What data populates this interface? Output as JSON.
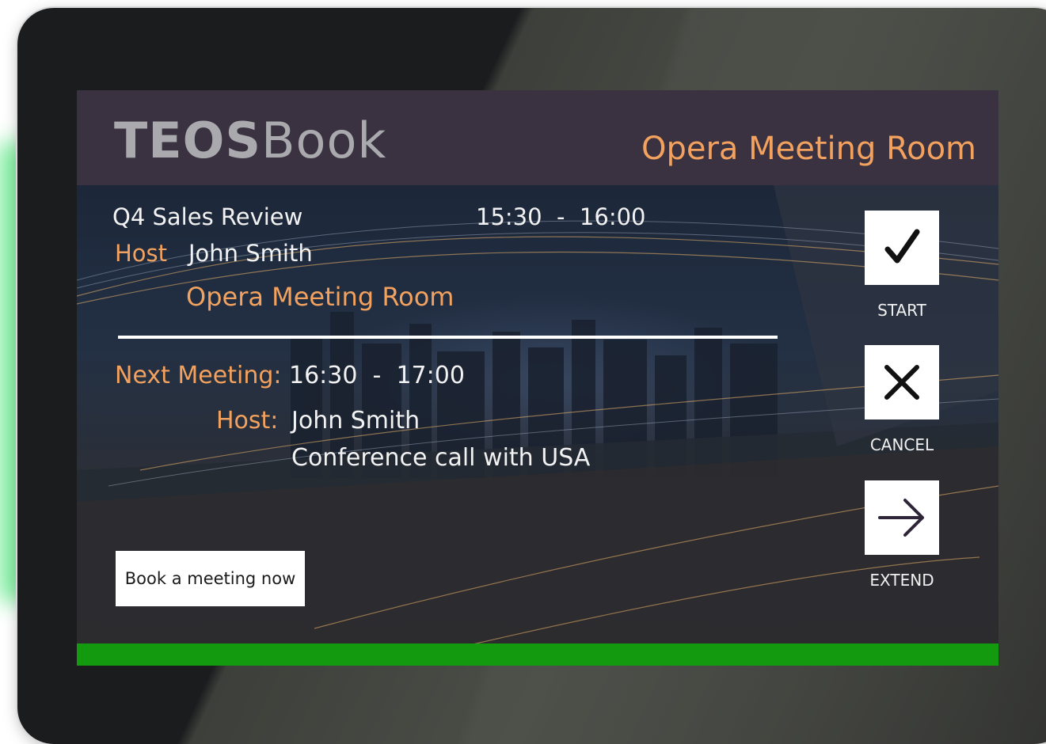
{
  "brand": {
    "bold": "TEOS",
    "light": "Book"
  },
  "room_title": "Opera Meeting Room",
  "current_meeting": {
    "title": "Q4 Sales Review",
    "time_start": "15:30",
    "time_sep": "-",
    "time_end": "16:00",
    "host_label": "Host",
    "host_name": "John Smith",
    "room": "Opera Meeting Room"
  },
  "next_meeting": {
    "label": "Next Meeting:",
    "time_start": "16:30",
    "time_sep": "-",
    "time_end": "17:00",
    "host_label": "Host:",
    "host_name": "John Smith",
    "description": "Conference call with USA"
  },
  "actions": {
    "start": {
      "label": "START",
      "icon": "checkmark-icon"
    },
    "cancel": {
      "label": "CANCEL",
      "icon": "close-icon"
    },
    "extend": {
      "label": "EXTEND",
      "icon": "arrow-right-icon"
    }
  },
  "book_button": "Book a meeting now",
  "colors": {
    "accent": "#f2a25e",
    "header_bg": "#3a3240",
    "status_available": "#149a0f",
    "brand_text": "#a9a9ae"
  }
}
